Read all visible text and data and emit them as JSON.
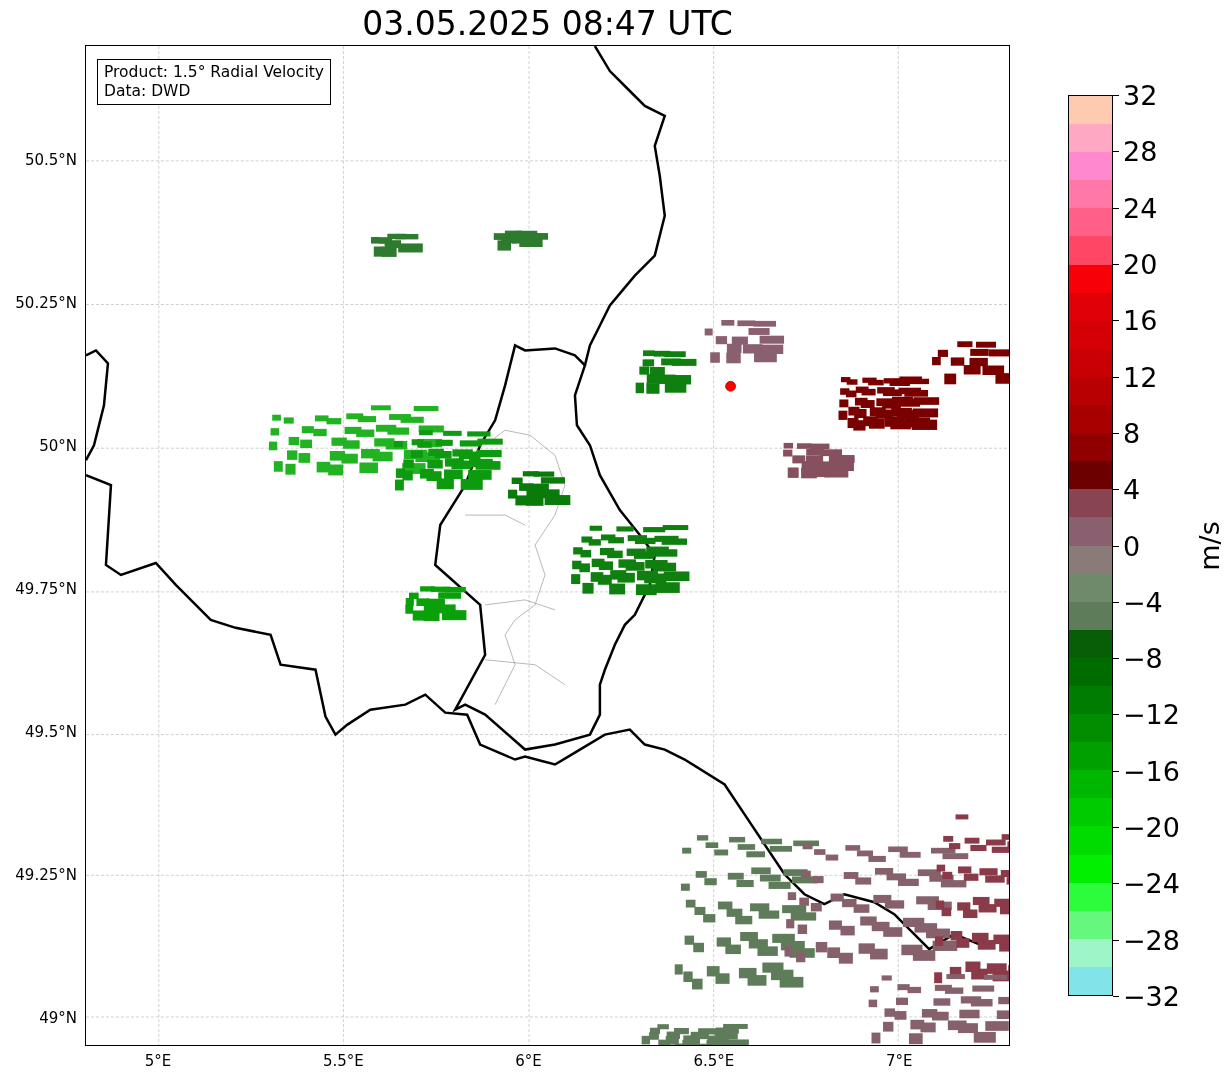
{
  "title": "03.05.2025 08:47 UTC",
  "legend": {
    "lines": [
      "Product: 1.5° Radial Velocity",
      "Data: DWD"
    ]
  },
  "map": {
    "y_ticks": [
      "50.5°N",
      "50.25°N",
      "50°N",
      "49.75°N",
      "49.5°N",
      "49.25°N",
      "49°N"
    ],
    "x_ticks": [
      "5°E",
      "5.5°E",
      "6°E",
      "6.5°E",
      "7°E"
    ]
  },
  "colorbar": {
    "label": "m/s",
    "ticks": [
      "32",
      "28",
      "24",
      "20",
      "16",
      "12",
      "8",
      "4",
      "0",
      "−4",
      "−8",
      "−12",
      "−16",
      "−20",
      "−24",
      "−28",
      "−32"
    ]
  }
}
